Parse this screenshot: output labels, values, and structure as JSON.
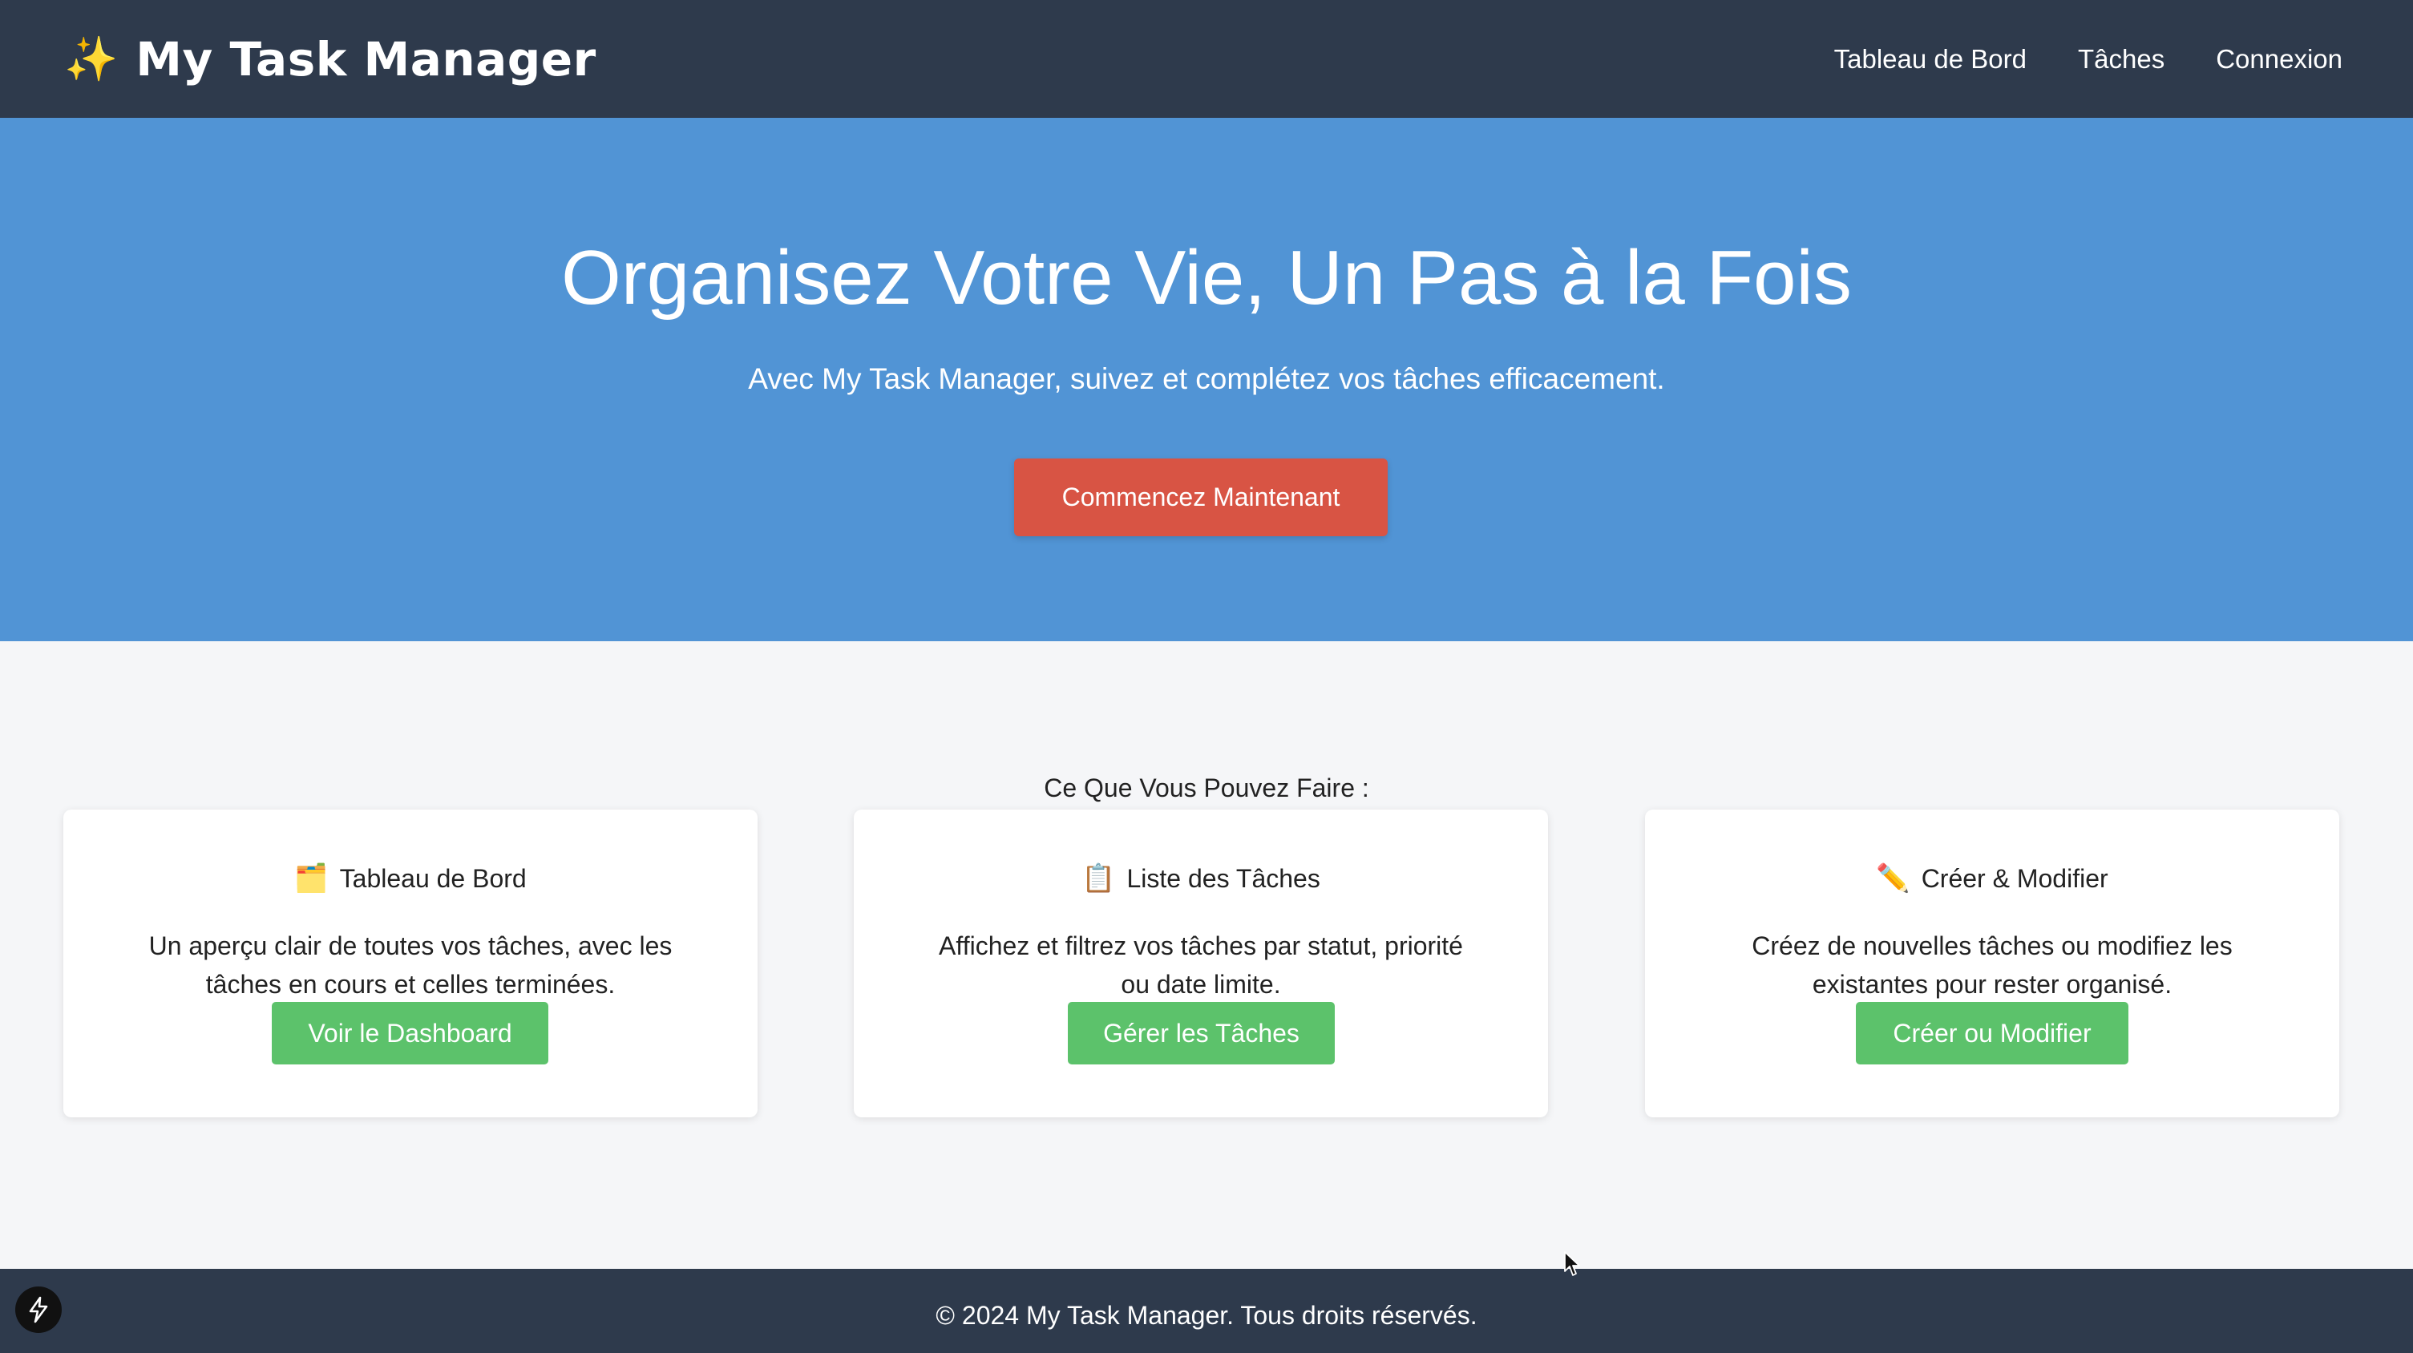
{
  "header": {
    "sparkle_icon": "sparkles",
    "brand_title": "My Task Manager",
    "nav": [
      "Tableau de Bord",
      "Tâches",
      "Connexion"
    ]
  },
  "hero": {
    "title": "Organisez Votre Vie, Un Pas à la Fois",
    "subtitle": "Avec My Task Manager, suivez et complétez vos tâches efficacement.",
    "cta_label": "Commencez Maintenant"
  },
  "features": {
    "heading": "Ce Que Vous Pouvez Faire :",
    "cards": [
      {
        "icon": "🗂️",
        "title": "Tableau de Bord",
        "description": "Un aperçu clair de toutes vos tâches, avec les tâches en cours et celles terminées.",
        "button": "Voir le Dashboard"
      },
      {
        "icon": "📋",
        "title": "Liste des Tâches",
        "description": "Affichez et filtrez vos tâches par statut, priorité ou date limite.",
        "button": "Gérer les Tâches"
      },
      {
        "icon": "✏️",
        "title": "Créer & Modifier",
        "description": "Créez de nouvelles tâches ou modifiez les existantes pour rester organisé.",
        "button": "Créer ou Modifier"
      }
    ]
  },
  "footer": {
    "copyright": "© 2024 My Task Manager. Tous droits réservés."
  },
  "colors": {
    "navbar": "#2e3a4c",
    "hero": "#5194d5",
    "cta": "#d85444",
    "card_button": "#5cc26b"
  }
}
